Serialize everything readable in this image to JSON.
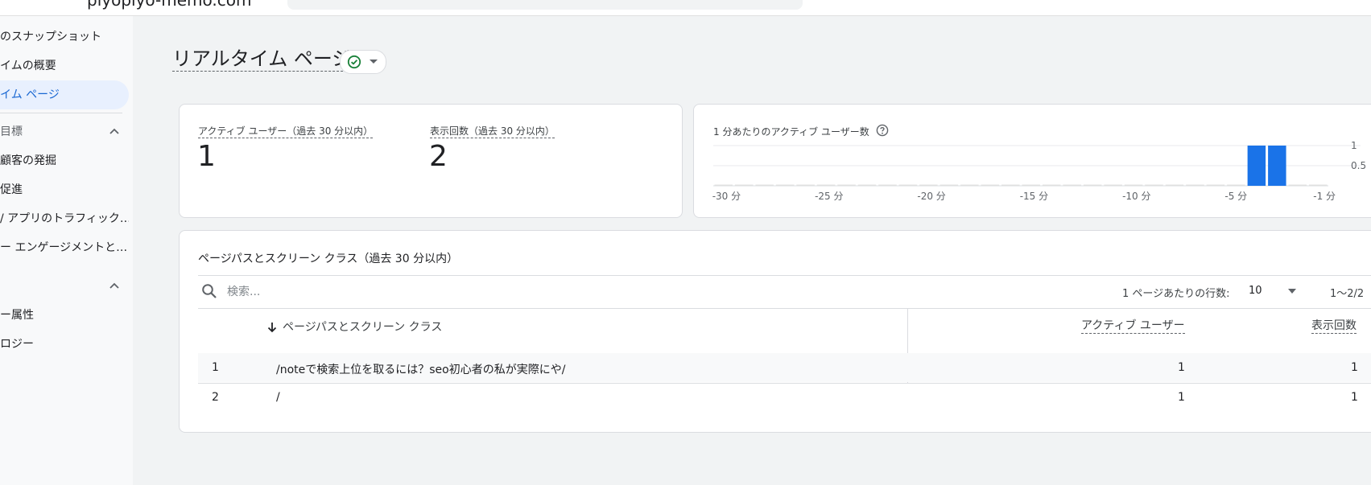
{
  "browser": {
    "site": "piyopiyo-memo.com"
  },
  "sidebar": {
    "items": [
      {
        "label": "のスナップショット"
      },
      {
        "label": "イムの概要"
      },
      {
        "label": "イム ページ"
      }
    ],
    "section1": {
      "label": "目標",
      "items": [
        {
          "label": "顧客の発掘"
        },
        {
          "label": "促進"
        },
        {
          "label": "/ アプリのトラフィック…"
        },
        {
          "label": "ー エンゲージメントと…"
        }
      ]
    },
    "section2": {
      "items": [
        {
          "label": "ー属性"
        },
        {
          "label": "ロジー"
        }
      ]
    }
  },
  "page": {
    "title": "リアルタイム ページ"
  },
  "metrics": {
    "active_users_label": "アクティブ ユーザー（過去 30 分以内）",
    "active_users_value": "1",
    "views_label": "表示回数（過去 30 分以内）",
    "views_value": "2"
  },
  "chart_data": {
    "type": "bar",
    "title": "1 分あたりのアクティブ ユーザー数",
    "x_ticks": [
      "-30 分",
      "-25 分",
      "-20 分",
      "-15 分",
      "-10 分",
      "-5 分",
      "-1 分"
    ],
    "y_ticks": [
      "1",
      "0.5"
    ],
    "ylim": [
      0,
      1
    ],
    "values": [
      0,
      0,
      0,
      0,
      0,
      0,
      0,
      0,
      0,
      0,
      0,
      0,
      0,
      0,
      0,
      0,
      0,
      0,
      0,
      0,
      0,
      0,
      0,
      0,
      0,
      0,
      1,
      1,
      0,
      0
    ],
    "bar_color": "#1a73e8",
    "grid": true
  },
  "table": {
    "title": "ページパスとスクリーン クラス（過去 30 分以内）",
    "search_placeholder": "検索...",
    "rows_per_page_label": "1 ページあたりの行数:",
    "rows_per_page_value": "10",
    "pagination": "1〜2/2",
    "columns": {
      "path": "ページパスとスクリーン クラス",
      "active_users": "アクティブ ユーザー",
      "views": "表示回数"
    },
    "rows": [
      {
        "index": "1",
        "path": "/noteで検索上位を取るには？seo初心者の私が実際にや/",
        "active_users": "1",
        "views": "1"
      },
      {
        "index": "2",
        "path": "/",
        "active_users": "1",
        "views": "1"
      }
    ]
  },
  "colors": {
    "accent": "#1a73e8",
    "success": "#188038",
    "active_nav_bg": "#e8f0fe"
  }
}
